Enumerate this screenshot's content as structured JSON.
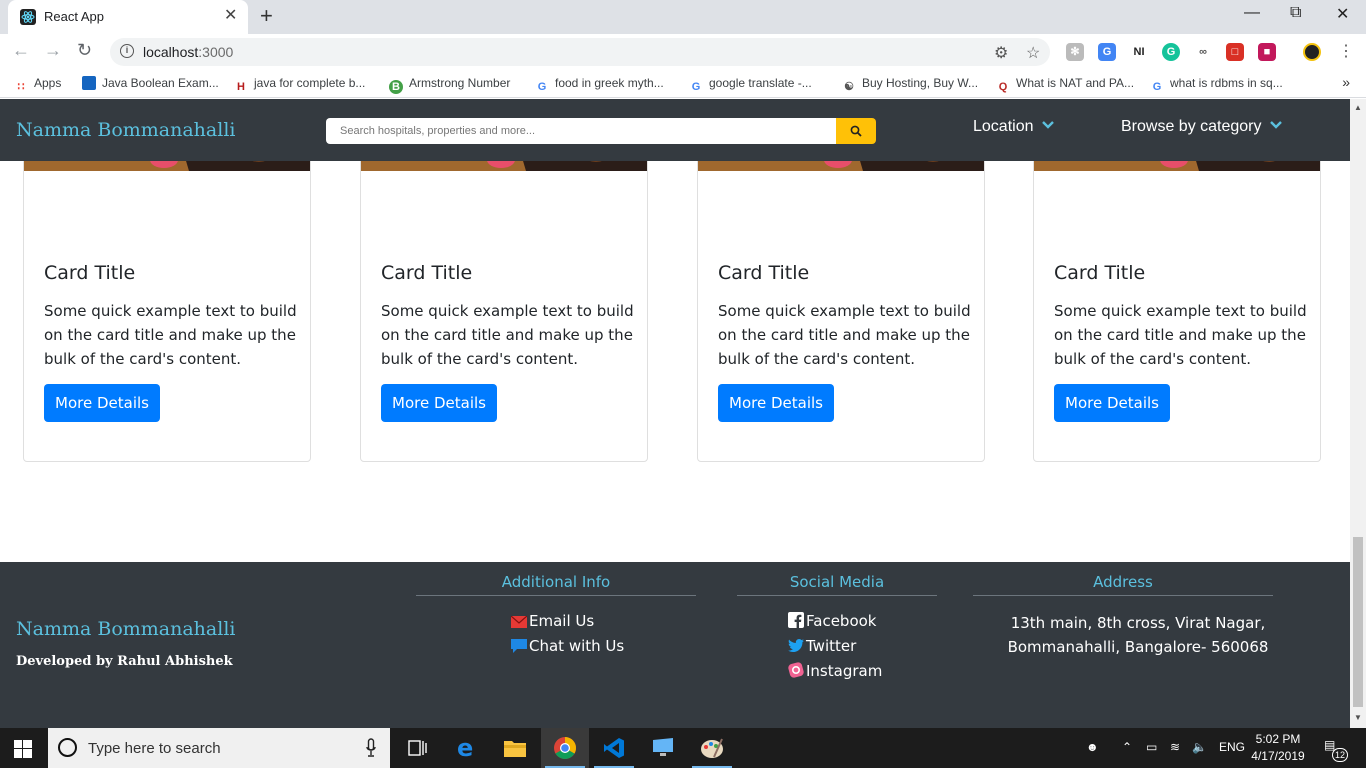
{
  "browser": {
    "tab_title": "React App",
    "url_host": "localhost",
    "url_port": ":3000",
    "bookmarks": [
      {
        "label": "Apps",
        "icon": "apps-grid-icon"
      },
      {
        "label": "Java Boolean Exam...",
        "icon": "java-icon"
      },
      {
        "label": "java for complete b...",
        "icon": "hl-icon"
      },
      {
        "label": "Armstrong Number",
        "icon": "b-icon"
      },
      {
        "label": "food in greek myth...",
        "icon": "google-icon"
      },
      {
        "label": "google translate -...",
        "icon": "google-icon"
      },
      {
        "label": "Buy Hosting, Buy W...",
        "icon": "hosting-icon"
      },
      {
        "label": "What is NAT and PA...",
        "icon": "quora-icon"
      },
      {
        "label": "what is rdbms in sq...",
        "icon": "google-icon"
      }
    ]
  },
  "site": {
    "brand": "Namma Bommanahalli",
    "search_placeholder": "Search hospitals, properties and more...",
    "nav": {
      "location": "Location",
      "category": "Browse by category"
    },
    "cards": [
      {
        "title": "Card Title",
        "text": "Some quick example text to build on the card title and make up the bulk of the card's content.",
        "button": "More Details"
      },
      {
        "title": "Card Title",
        "text": "Some quick example text to build on the card title and make up the bulk of the card's content.",
        "button": "More Details"
      },
      {
        "title": "Card Title",
        "text": "Some quick example text to build on the card title and make up the bulk of the card's content.",
        "button": "More Details"
      },
      {
        "title": "Card Title",
        "text": "Some quick example text to build on the card title and make up the bulk of the card's content.",
        "button": "More Details"
      }
    ],
    "footer": {
      "brand": "Namma Bommanahalli",
      "developer": "Developed by Rahul Abhishek",
      "additional_info": {
        "heading": "Additional Info",
        "links": [
          "Email Us",
          "Chat with Us"
        ]
      },
      "social": {
        "heading": "Social Media",
        "links": [
          "Facebook",
          "Twitter",
          "Instagram"
        ]
      },
      "address": {
        "heading": "Address",
        "line1": "13th main, 8th cross, Virat Nagar,",
        "line2": "Bommanahalli, Bangalore- 560068"
      }
    }
  },
  "taskbar": {
    "search_placeholder": "Type here to search",
    "language": "ENG",
    "time": "5:02 PM",
    "date": "4/17/2019",
    "notifications": "12"
  },
  "colors": {
    "brand": "#5bc0de",
    "navbar_bg": "#343a40",
    "primary_button": "#007bff",
    "search_button": "#ffc107"
  }
}
